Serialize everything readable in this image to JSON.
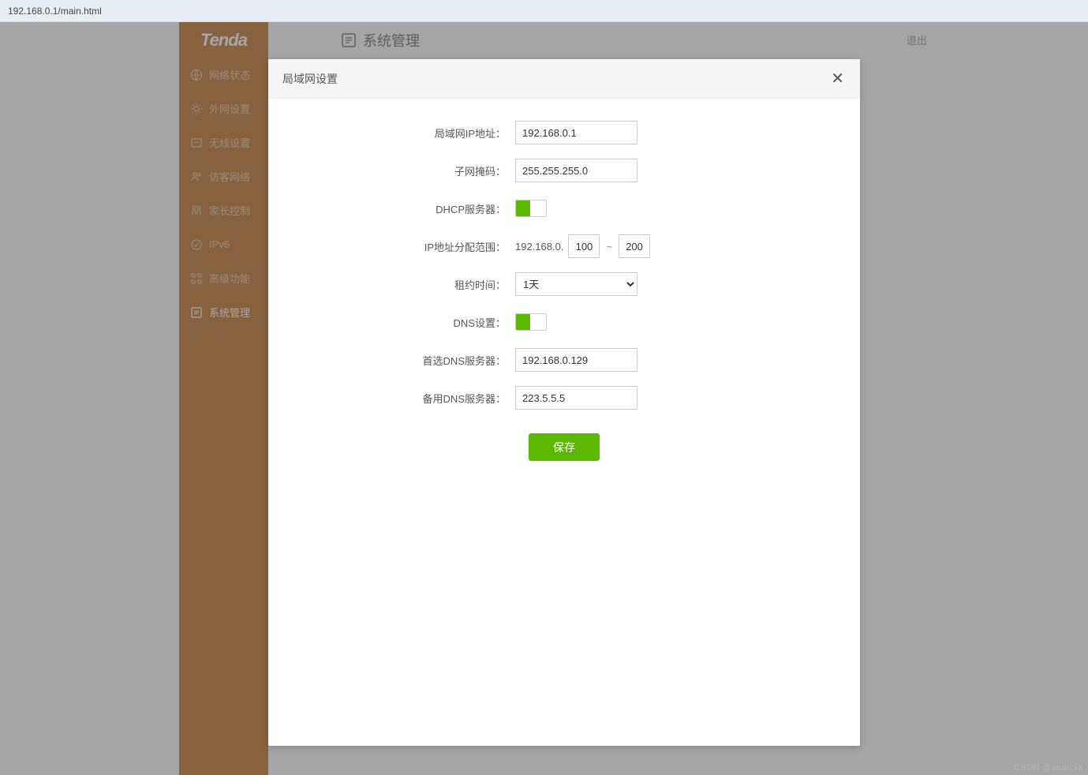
{
  "url_bar": "192.168.0.1/main.html",
  "brand": "Tenda",
  "sidebar": {
    "items": [
      {
        "label": "网络状态"
      },
      {
        "label": "外网设置"
      },
      {
        "label": "无线设置"
      },
      {
        "label": "访客网络"
      },
      {
        "label": "家长控制"
      },
      {
        "label": "IPv6"
      },
      {
        "label": "高级功能"
      },
      {
        "label": "系统管理"
      }
    ]
  },
  "header": {
    "title": "系统管理",
    "logout": "退出"
  },
  "modal": {
    "title": "局域网设置",
    "labels": {
      "lan_ip": "局域网IP地址：",
      "subnet": "子网掩码：",
      "dhcp": "DHCP服务器：",
      "range": "IP地址分配范围：",
      "lease": "租约时间：",
      "dns": "DNS设置：",
      "dns1": "首选DNS服务器：",
      "dns2": "备用DNS服务器："
    },
    "values": {
      "lan_ip": "192.168.0.1",
      "subnet": "255.255.255.0",
      "range_prefix": "192.168.0.",
      "range_start": "100",
      "range_sep": "~",
      "range_end": "200",
      "lease": "1天",
      "dns1": "192.168.0.129",
      "dns2": "223.5.5.5"
    },
    "save": "保存"
  },
  "watermark": "CSDN @anarckk"
}
